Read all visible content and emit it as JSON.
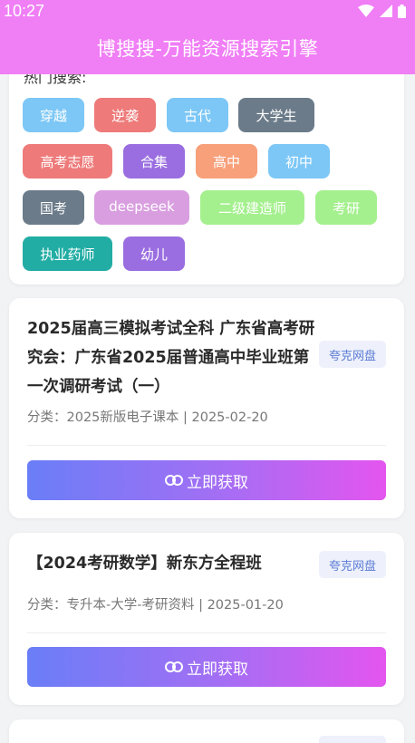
{
  "status": {
    "time": "10:27"
  },
  "header": {
    "title": "博搜搜-万能资源搜索引擎"
  },
  "hot": {
    "title": "热门搜索:",
    "tags": [
      {
        "label": "穿越",
        "color": "#7cc7f6"
      },
      {
        "label": "逆袭",
        "color": "#ee7a7a"
      },
      {
        "label": "古代",
        "color": "#7cc7f6"
      },
      {
        "label": "大学生",
        "color": "#6b7b89"
      },
      {
        "label": "高考志愿",
        "color": "#ee7a7a"
      },
      {
        "label": "合集",
        "color": "#9a6ee0"
      },
      {
        "label": "高中",
        "color": "#f7a07a"
      },
      {
        "label": "初中",
        "color": "#7cc7f6"
      },
      {
        "label": "国考",
        "color": "#6b7b89"
      },
      {
        "label": "deepseek",
        "color": "#d99ee0"
      },
      {
        "label": "二级建造师",
        "color": "#a4f08e"
      },
      {
        "label": "考研",
        "color": "#a4f08e"
      },
      {
        "label": "执业药师",
        "color": "#22ada4"
      },
      {
        "label": "幼儿",
        "color": "#9a6ee0"
      }
    ]
  },
  "results": [
    {
      "title": "2025届高三模拟考试全科 广东省高考研究会：广东省2025届普通高中毕业班第一次调研考试（一）",
      "badge": "夸克网盘",
      "meta": "分类：2025新版电子课本 | 2025-02-20",
      "button": "立即获取"
    },
    {
      "title": "【2024考研数学】新东方全程班",
      "badge": "夸克网盘",
      "meta": "分类：专升本-大学-考研资料 | 2025-01-20",
      "button": "立即获取"
    }
  ]
}
